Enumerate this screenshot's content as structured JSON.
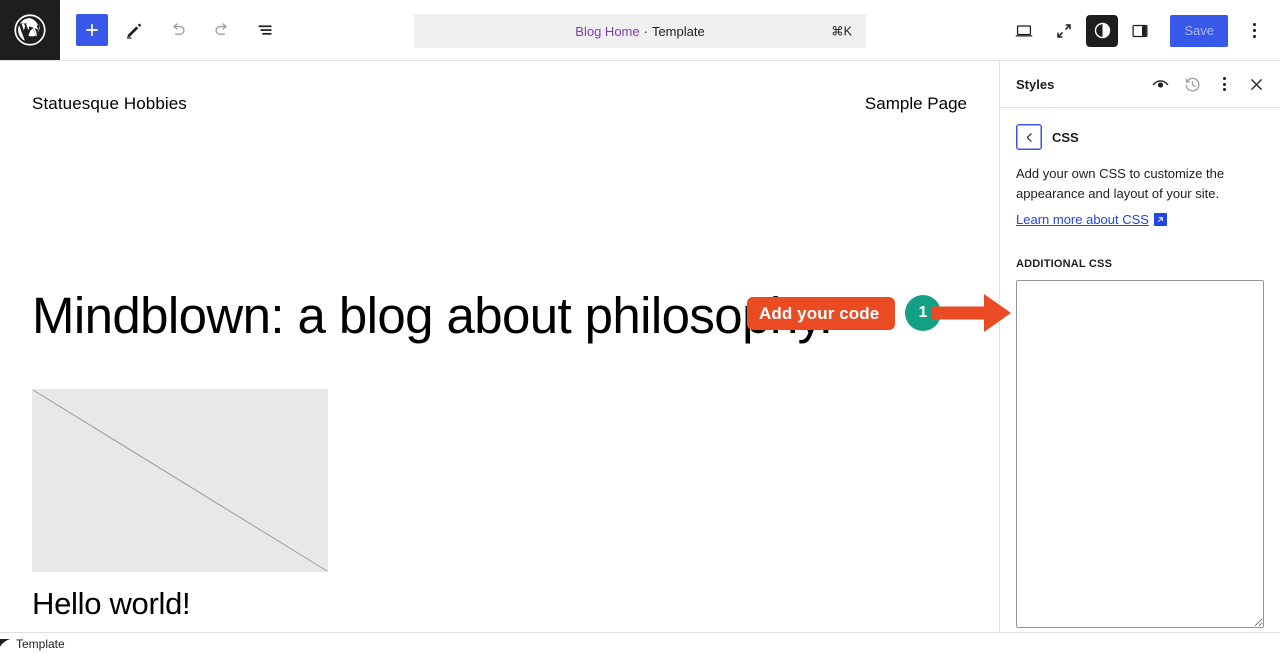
{
  "topbar": {
    "logo_icon": "wordpress-logo-icon",
    "add_block_label": "+",
    "buttons": [
      {
        "name": "add-block-button",
        "icon": "plus-icon"
      },
      {
        "name": "edit-tool-button",
        "icon": "pencil-icon"
      },
      {
        "name": "undo-button",
        "icon": "undo-arrow-icon"
      },
      {
        "name": "redo-button",
        "icon": "redo-arrow-icon"
      },
      {
        "name": "document-overview-button",
        "icon": "list-view-icon"
      }
    ],
    "command_center": {
      "document_name": "Blog Home",
      "separator": "·",
      "document_type": "Template",
      "shortcut": "⌘K"
    },
    "right_buttons": [
      {
        "name": "view-device-button",
        "icon": "laptop-icon"
      },
      {
        "name": "zoom-out-button",
        "icon": "expand-icon"
      },
      {
        "name": "styles-button",
        "icon": "contrast-circle-icon"
      },
      {
        "name": "settings-sidebar-button",
        "icon": "sidebar-panel-icon"
      }
    ],
    "save_label": "Save",
    "options_icon": "vertical-ellipsis-icon"
  },
  "canvas": {
    "site_title": "Statuesque Hobbies",
    "nav_link": "Sample Page",
    "blog_heading": "Mindblown: a blog about philosophy.",
    "post_image_alt": "broken-image-placeholder",
    "post_title": "Hello world!"
  },
  "sidebar": {
    "title": "Styles",
    "header_icons": [
      {
        "name": "style-book-eye-icon",
        "icon": "eye-icon"
      },
      {
        "name": "revisions-history-icon",
        "icon": "clock-counterclockwise-icon"
      },
      {
        "name": "styles-options-icon",
        "icon": "vertical-ellipsis-icon"
      },
      {
        "name": "close-styles-icon",
        "icon": "close-x-icon"
      }
    ],
    "back_icon": "chevron-left-icon",
    "section_heading": "CSS",
    "description": "Add your own CSS to customize the appearance and layout of your site.",
    "learn_more_label": "Learn more about CSS",
    "learn_more_icon": "external-link-icon",
    "additional_css_label": "ADDITIONAL CSS",
    "css_value": "",
    "css_placeholder": ""
  },
  "bottombar": {
    "breadcrumb": "Template"
  },
  "annotation": {
    "label": "Add your code",
    "step_number": "1",
    "label_color": "#ea4b23",
    "badge_color": "#13a085",
    "arrow_color": "#ea4b23"
  },
  "colors": {
    "accent_blue": "#3858e9",
    "link_blue": "#2145e6",
    "doc_purple": "#7b3fb5",
    "dark": "#1e1e1e"
  }
}
